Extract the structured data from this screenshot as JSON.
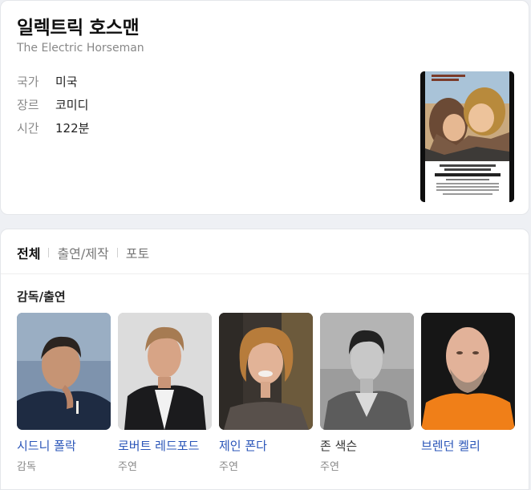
{
  "movie": {
    "title": "일렉트릭 호스맨",
    "original_title": "The Electric Horseman",
    "meta": [
      {
        "label": "국가",
        "value": "미국"
      },
      {
        "label": "장르",
        "value": "코미디"
      },
      {
        "label": "시간",
        "value": "122분"
      }
    ],
    "poster": {
      "names": "ROBERT REDFORD · JANE FONDA",
      "title": "THE ELECTRIC HORSEMAN"
    }
  },
  "tabs": [
    {
      "label": "전체",
      "active": true
    },
    {
      "label": "출연/제작",
      "active": false
    },
    {
      "label": "포토",
      "active": false
    }
  ],
  "section_title": "감독/출연",
  "people": [
    {
      "name": "시드니 폴락",
      "role": "감독"
    },
    {
      "name": "로버트 레드포드",
      "role": "주연"
    },
    {
      "name": "제인 폰다",
      "role": "주연"
    },
    {
      "name": "존 색슨",
      "role": "주연"
    },
    {
      "name": "브렌던 켈리",
      "role": ""
    }
  ],
  "colors": {
    "link": "#2a55b8",
    "muted": "#8a8a8a",
    "background": "#eef0f4"
  }
}
